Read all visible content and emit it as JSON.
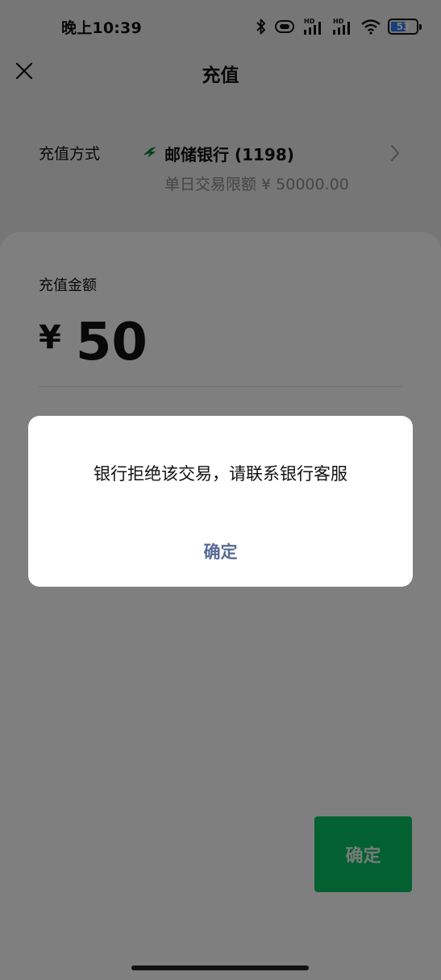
{
  "status_bar": {
    "time": "晚上10:39",
    "battery_level": "53",
    "battery_color": "#2f7df6",
    "signal_tag_1": "HD",
    "signal_tag_2": "HD",
    "icons": [
      "bluetooth-icon",
      "vibrate-icon",
      "signal-icon",
      "signal-icon",
      "wifi-icon",
      "battery-icon"
    ]
  },
  "nav": {
    "title": "充值",
    "close_icon": "close-icon"
  },
  "payment_method": {
    "label": "充值方式",
    "bank_name": "邮储银行 (1198)",
    "limit": "单日交易限额 ¥ 50000.00",
    "bank_color": "#00813a"
  },
  "amount": {
    "label": "充值金额",
    "currency": "¥",
    "value": "50"
  },
  "confirm_button": {
    "label": "确定",
    "color": "#07c160"
  },
  "dialog": {
    "message": "银行拒绝该交易，请联系银行客服",
    "button_label": "确定",
    "button_color": "#576b95"
  },
  "overlay_color": "rgba(0,0,0,0.5)"
}
